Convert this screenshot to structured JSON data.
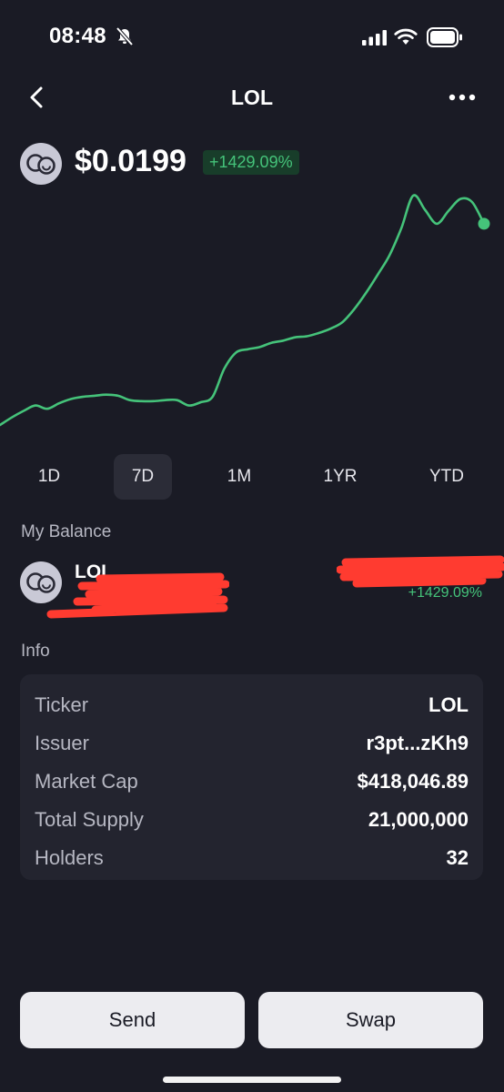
{
  "status_bar": {
    "time": "08:48"
  },
  "nav": {
    "title": "LOL"
  },
  "token": {
    "price": "$0.0199",
    "change": "+1429.09%"
  },
  "chart_data": {
    "type": "line",
    "series": [
      {
        "values": [
          0.0013,
          0.002,
          0.0026,
          0.0031,
          0.0028,
          0.0033,
          0.0037,
          0.0039,
          0.004,
          0.0041,
          0.004,
          0.0036,
          0.0035,
          0.0035,
          0.0036,
          0.0036,
          0.0031,
          0.0034,
          0.0039,
          0.0065,
          0.008,
          0.0083,
          0.0085,
          0.0089,
          0.0091,
          0.0094,
          0.0095,
          0.0098,
          0.0102,
          0.0108,
          0.012,
          0.0135,
          0.0152,
          0.017,
          0.0195,
          0.0225,
          0.0212,
          0.0199,
          0.0211,
          0.0222,
          0.0219,
          0.0199
        ]
      }
    ],
    "grid": false,
    "color": "#45c37a"
  },
  "range_tabs": [
    {
      "label": "1D",
      "active": false
    },
    {
      "label": "7D",
      "active": true
    },
    {
      "label": "1M",
      "active": false
    },
    {
      "label": "1YR",
      "active": false
    },
    {
      "label": "YTD",
      "active": false
    }
  ],
  "balance": {
    "section_label": "My Balance",
    "token_name": "LOL",
    "change": "+1429.09%"
  },
  "info": {
    "section_label": "Info",
    "rows": [
      {
        "label": "Ticker",
        "value": "LOL"
      },
      {
        "label": "Issuer",
        "value": "r3pt...zKh9"
      },
      {
        "label": "Market Cap",
        "value": "$418,046.89"
      },
      {
        "label": "Total Supply",
        "value": "21,000,000"
      },
      {
        "label": "Holders",
        "value": "32"
      }
    ]
  },
  "actions": {
    "send_label": "Send",
    "swap_label": "Swap"
  },
  "colors": {
    "background": "#1a1b25",
    "card": "#23242f",
    "accent_green": "#45c37a",
    "badge_bg": "#183d2a",
    "redaction": "#ff3b30"
  }
}
